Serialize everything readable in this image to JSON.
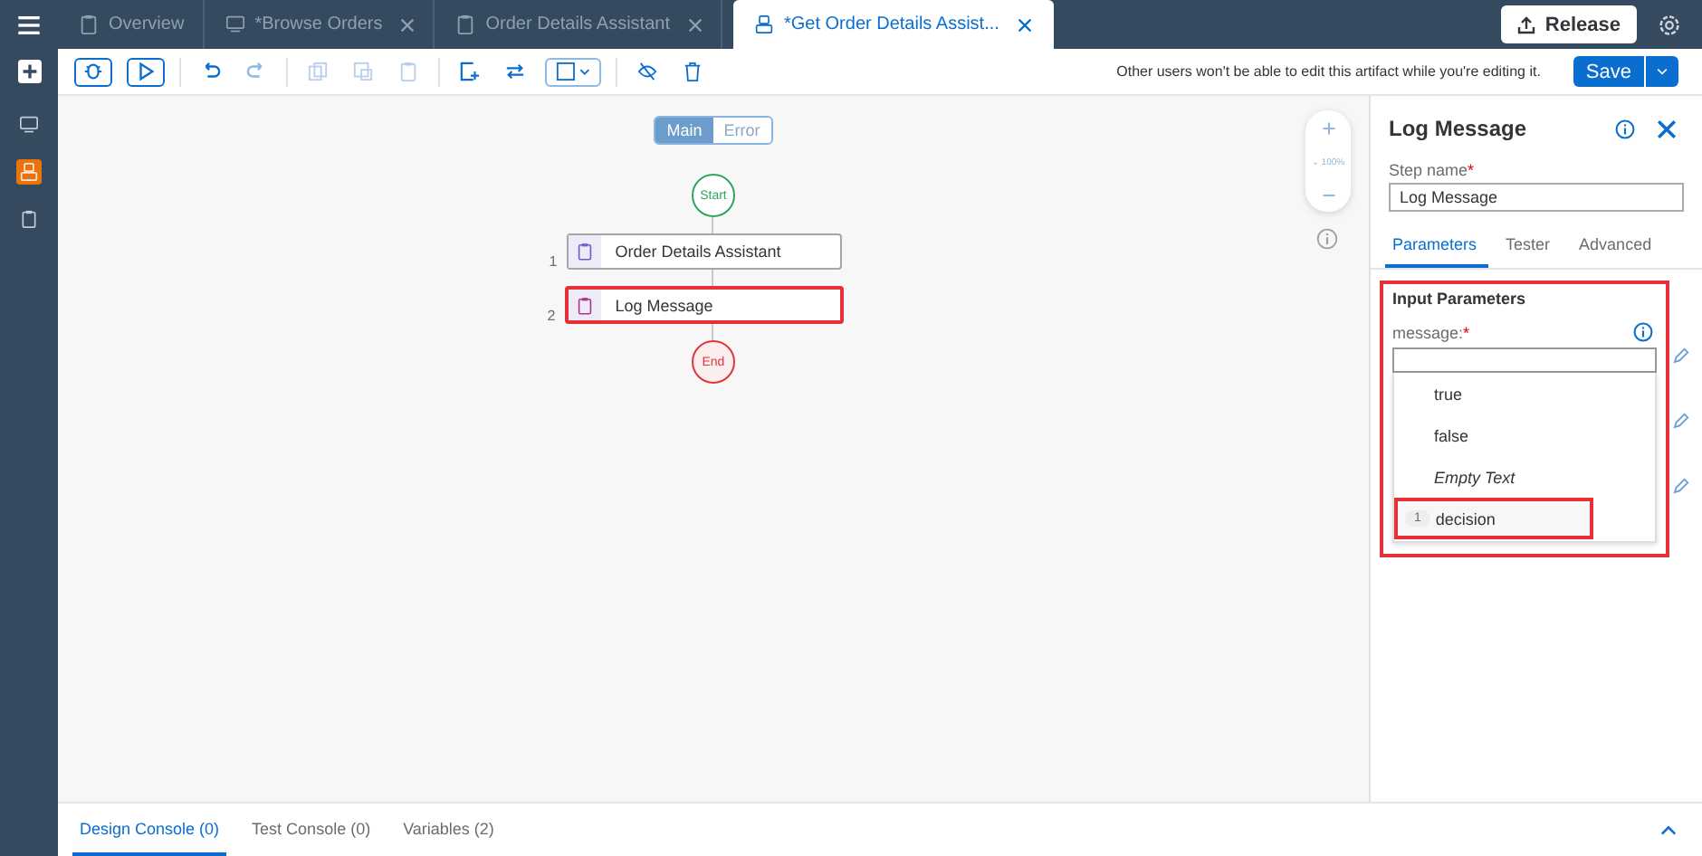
{
  "header": {
    "tabs": [
      {
        "label": "Overview",
        "kind": "clipboard",
        "selected": false,
        "closable": false
      },
      {
        "label": "*Browse Orders",
        "kind": "monitor",
        "selected": false,
        "closable": true
      },
      {
        "label": "Order Details Assistant",
        "kind": "clipboard",
        "selected": false,
        "closable": true
      },
      {
        "label": "*Get Order Details Assist...",
        "kind": "robot",
        "selected": true,
        "closable": true
      }
    ],
    "release_button": "Release"
  },
  "rail": {
    "items": [
      {
        "kind": "monitor",
        "selected": false
      },
      {
        "kind": "robot",
        "selected": true
      },
      {
        "kind": "clipboard",
        "selected": false
      }
    ]
  },
  "toolbar": {
    "notice": "Other users won't be able to edit this artifact while you're editing it.",
    "save_button": "Save"
  },
  "canvas": {
    "switch": [
      {
        "label": "Main",
        "selected": true
      },
      {
        "label": "Error",
        "selected": false
      }
    ],
    "zoom": "100%",
    "zoom_caret": "⌄",
    "start": "Start",
    "end": "End",
    "steps": [
      {
        "number": "1",
        "label": "Order Details Assistant",
        "color": "#6c5fc7",
        "highlighted": false
      },
      {
        "number": "2",
        "label": "Log Message",
        "color": "#a3398f",
        "highlighted": true
      }
    ]
  },
  "panel": {
    "title": "Log Message",
    "step_name_label": "Step name",
    "step_name_marker": "*",
    "step_name": "Log Message",
    "tabs": [
      {
        "label": "Parameters",
        "selected": true
      },
      {
        "label": "Tester",
        "selected": false
      },
      {
        "label": "Advanced",
        "selected": false
      }
    ],
    "section_title": "Input Parameters",
    "section_highlighted": true,
    "param_label": "message:",
    "param_marker": "*",
    "options": [
      {
        "kind": "plain",
        "label": "true",
        "highlighted": false
      },
      {
        "kind": "plain",
        "label": "false",
        "highlighted": false
      },
      {
        "kind": "empty",
        "label": "Empty Text",
        "highlighted": false
      },
      {
        "kind": "variable",
        "badge": "1",
        "label": "decision",
        "highlighted": true
      }
    ]
  },
  "bottom_tabs": [
    {
      "label": "Design Console (0)",
      "selected": true
    },
    {
      "label": "Test Console (0)",
      "selected": false
    },
    {
      "label": "Variables (2)",
      "selected": false
    }
  ]
}
